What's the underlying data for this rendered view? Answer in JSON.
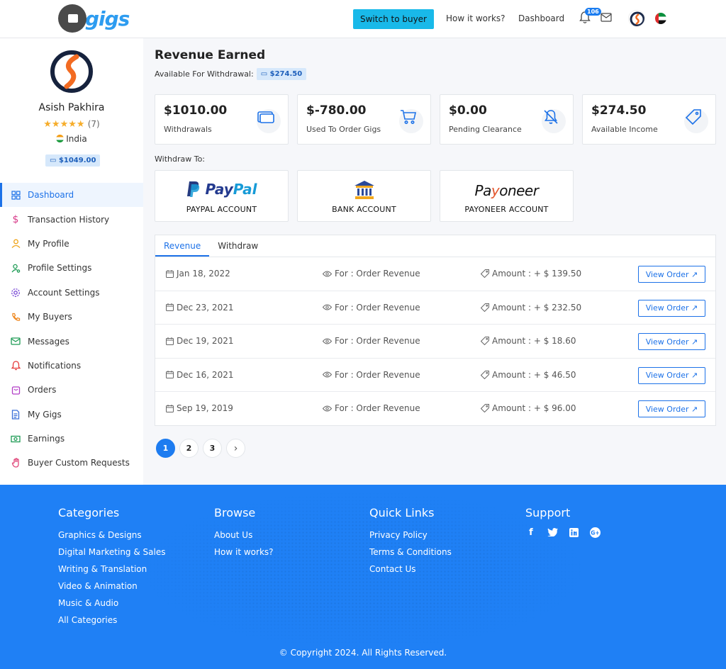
{
  "header": {
    "logo_text": "gigs",
    "switch_button": "Switch to buyer",
    "nav": [
      "How it works?",
      "Dashboard"
    ],
    "notification_count": "106"
  },
  "profile": {
    "name": "Asish Pakhira",
    "rating_stars": "★★★★★",
    "rating_count": "(7)",
    "rating_value": 4.5,
    "country": "India",
    "balance": "$1049.00"
  },
  "sidebar": {
    "items": [
      {
        "label": "Dashboard",
        "icon": "grid-icon"
      },
      {
        "label": "Transaction History",
        "icon": "dollar-icon"
      },
      {
        "label": "My Profile",
        "icon": "user-icon"
      },
      {
        "label": "Profile Settings",
        "icon": "user-settings-icon"
      },
      {
        "label": "Account Settings",
        "icon": "gear-icon"
      },
      {
        "label": "My Buyers",
        "icon": "phone-icon"
      },
      {
        "label": "Messages",
        "icon": "mail-icon"
      },
      {
        "label": "Notifications",
        "icon": "bell-icon"
      },
      {
        "label": "Orders",
        "icon": "bag-icon"
      },
      {
        "label": "My Gigs",
        "icon": "document-icon"
      },
      {
        "label": "Earnings",
        "icon": "cash-icon"
      },
      {
        "label": "Buyer Custom Requests",
        "icon": "hand-icon"
      }
    ]
  },
  "main": {
    "title": "Revenue Earned",
    "available_label": "Available For Withdrawal:",
    "available_amount": "$274.50",
    "stats": [
      {
        "value": "$1010.00",
        "label": "Withdrawals",
        "icon": "wallet-icon"
      },
      {
        "value": "$-780.00",
        "label": "Used To Order Gigs",
        "icon": "cart-icon"
      },
      {
        "value": "$0.00",
        "label": "Pending Clearance",
        "icon": "bell-off-icon"
      },
      {
        "value": "$274.50",
        "label": "Available Income",
        "icon": "tag-icon"
      }
    ],
    "withdraw_to": "Withdraw To:",
    "accounts": [
      {
        "label": "PAYPAL ACCOUNT",
        "logo_a": "Pay",
        "logo_b": "Pal"
      },
      {
        "label": "BANK ACCOUNT"
      },
      {
        "label": "PAYONEER ACCOUNT",
        "logo_a": "Pa",
        "logo_b": "y",
        "logo_c": "oneer"
      }
    ],
    "tabs": [
      "Revenue",
      "Withdraw"
    ],
    "rows": [
      {
        "date": "Jan 18, 2022",
        "for": "For : Order Revenue",
        "amount": "Amount : + $ 139.50",
        "action": "View Order ↗"
      },
      {
        "date": "Dec 23, 2021",
        "for": "For : Order Revenue",
        "amount": "Amount : + $ 232.50",
        "action": "View Order ↗"
      },
      {
        "date": "Dec 19, 2021",
        "for": "For : Order Revenue",
        "amount": "Amount : + $ 18.60",
        "action": "View Order ↗"
      },
      {
        "date": "Dec 16, 2021",
        "for": "For : Order Revenue",
        "amount": "Amount : + $ 46.50",
        "action": "View Order ↗"
      },
      {
        "date": "Sep 19, 2019",
        "for": "For : Order Revenue",
        "amount": "Amount : + $ 96.00",
        "action": "View Order ↗"
      }
    ],
    "pages": [
      "1",
      "2",
      "3"
    ],
    "next_glyph": "›"
  },
  "footer": {
    "categories_title": "Categories",
    "categories": [
      "Graphics & Designs",
      "Digital Marketing & Sales",
      "Writing & Translation",
      "Video & Animation",
      "Music & Audio",
      "All Categories"
    ],
    "browse_title": "Browse",
    "browse": [
      "About Us",
      "How it works?"
    ],
    "quick_title": "Quick Links",
    "quick": [
      "Privacy Policy",
      "Terms & Conditions",
      "Contact Us"
    ],
    "support_title": "Support",
    "socials": [
      {
        "icon": "facebook-icon",
        "glyph": "f"
      },
      {
        "icon": "twitter-icon",
        "glyph": "🐦"
      },
      {
        "icon": "linkedin-icon",
        "glyph": "in"
      },
      {
        "icon": "google-plus-icon",
        "glyph": "G+"
      }
    ],
    "copyright": "© Copyright 2024. All Rights Reserved."
  }
}
